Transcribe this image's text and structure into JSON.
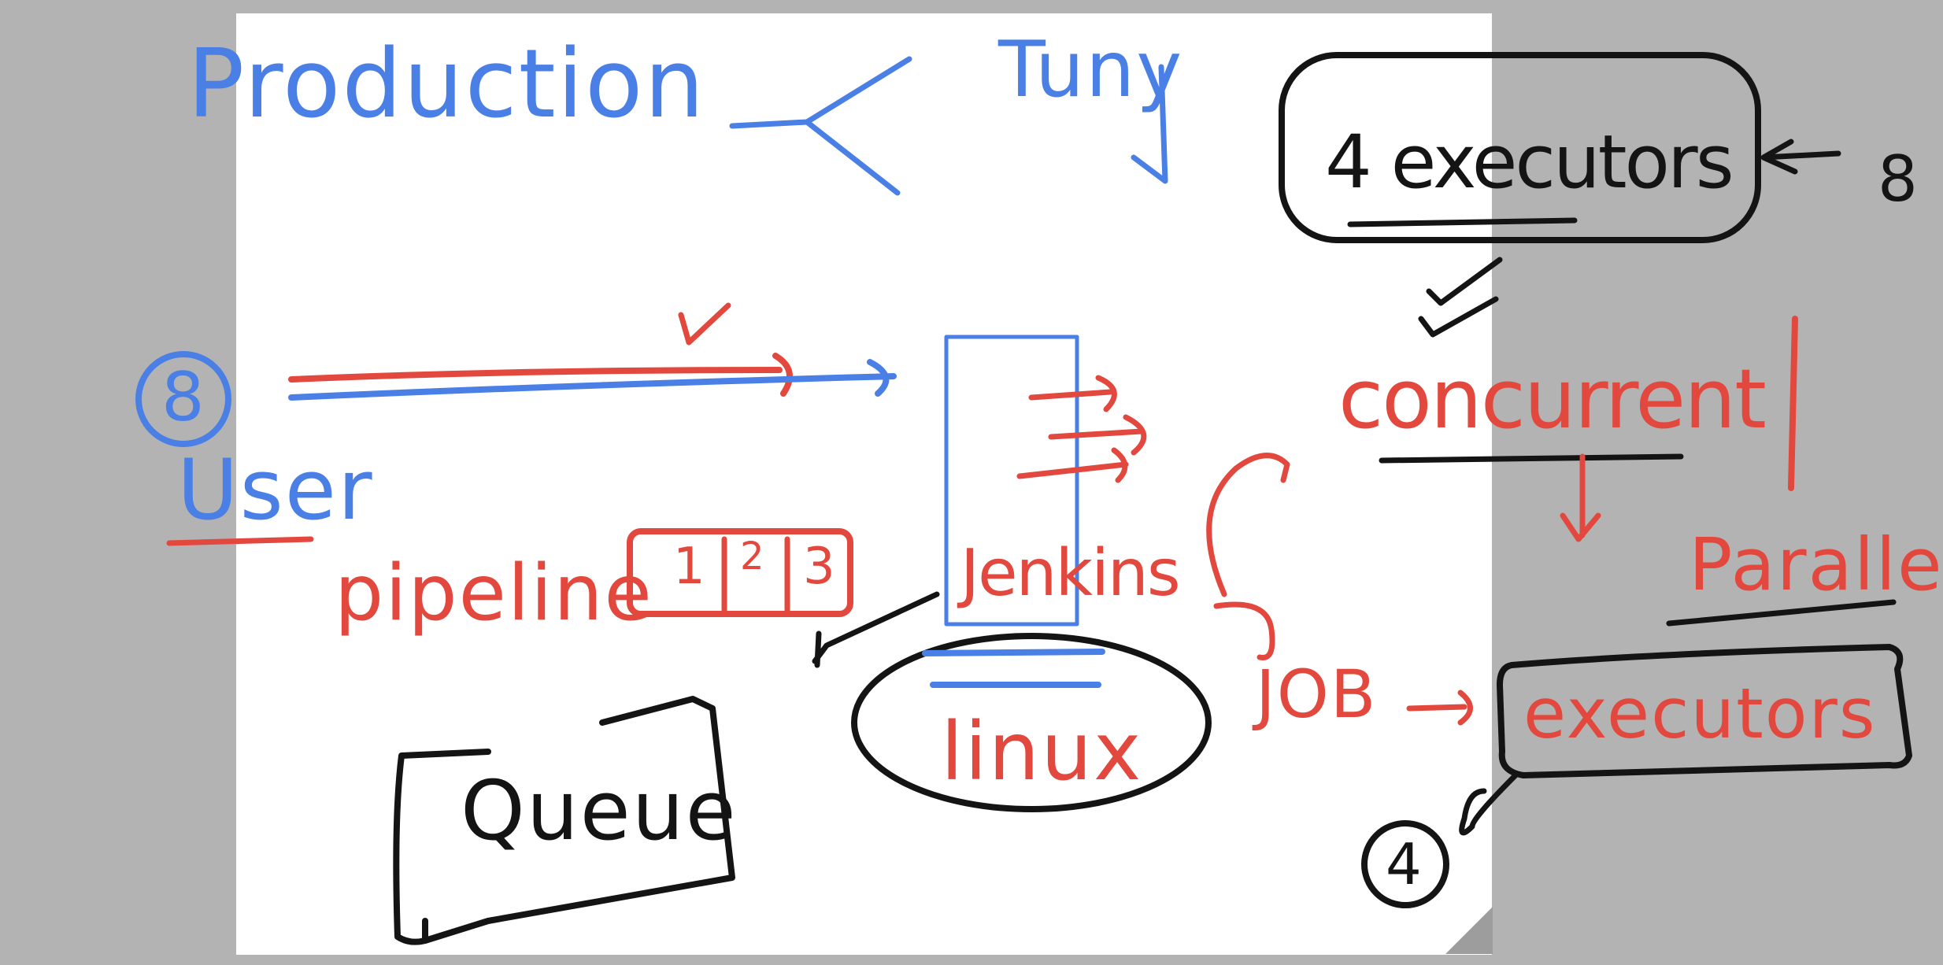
{
  "canvas": {
    "background": "#ffffff",
    "surround": "#b3b3b3"
  },
  "colors": {
    "blue": "#4a7fe6",
    "red": "#e2483d",
    "black": "#141414"
  },
  "notes": {
    "production": "Production",
    "tuny": "Tuny",
    "four_executors": "4 executors",
    "eight_right": "8",
    "eight_circle": "8",
    "user": "User",
    "pipeline": "pipeline",
    "stage_1": "1",
    "stage_2": "2",
    "stage_3": "3",
    "jenkins": "Jenkins",
    "linux": "linux",
    "queue": "Queue",
    "concurrent": "concurrent",
    "parallel": "Parallel",
    "job": "JOB",
    "executors": "executors",
    "four_circle": "4"
  }
}
